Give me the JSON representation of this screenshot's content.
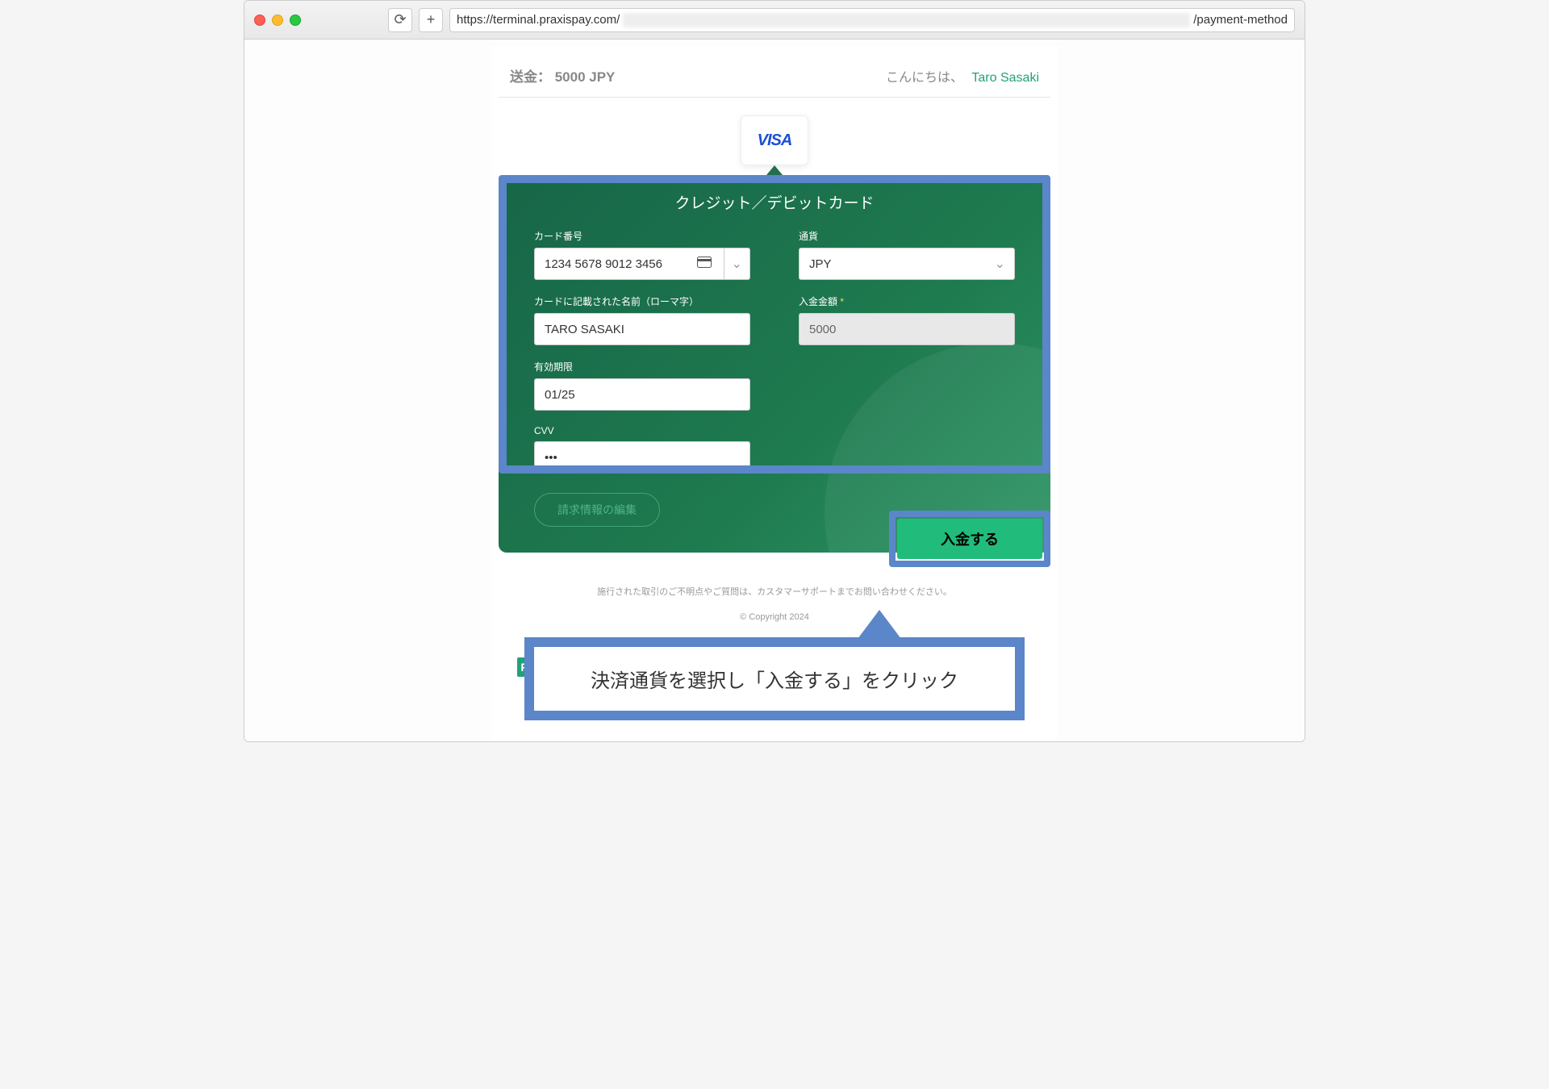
{
  "browser": {
    "url_prefix": "https://terminal.praxispay.com/",
    "url_suffix": "/payment-method"
  },
  "header": {
    "transfer": "送金： 5000 JPY",
    "greeting": "こんにちは、",
    "user_name": "Taro Sasaki"
  },
  "card_logo": "VISA",
  "panel": {
    "title": "クレジット／デビットカード",
    "fields": {
      "card_number_label": "カード番号",
      "card_number_value": "1234 5678 9012 3456",
      "currency_label": "通貨",
      "currency_value": "JPY",
      "name_label": "カードに記載された名前（ローマ字）",
      "name_value": "TARO SASAKI",
      "amount_label": "入金金額",
      "amount_required": "*",
      "amount_value": "5000",
      "expiry_label": "有効期限",
      "expiry_value": "01/25",
      "cvv_label": "CVV",
      "cvv_value": "•••"
    },
    "billing_edit": "請求情報の編集",
    "deposit_button": "入金する"
  },
  "footer": {
    "support": "施行された取引のご不明点やご質問は、カスタマーサポートまでお問い合わせください。",
    "copyright": "© Copyright 2024"
  },
  "callout": "決済通貨を選択し「入金する」をクリック"
}
